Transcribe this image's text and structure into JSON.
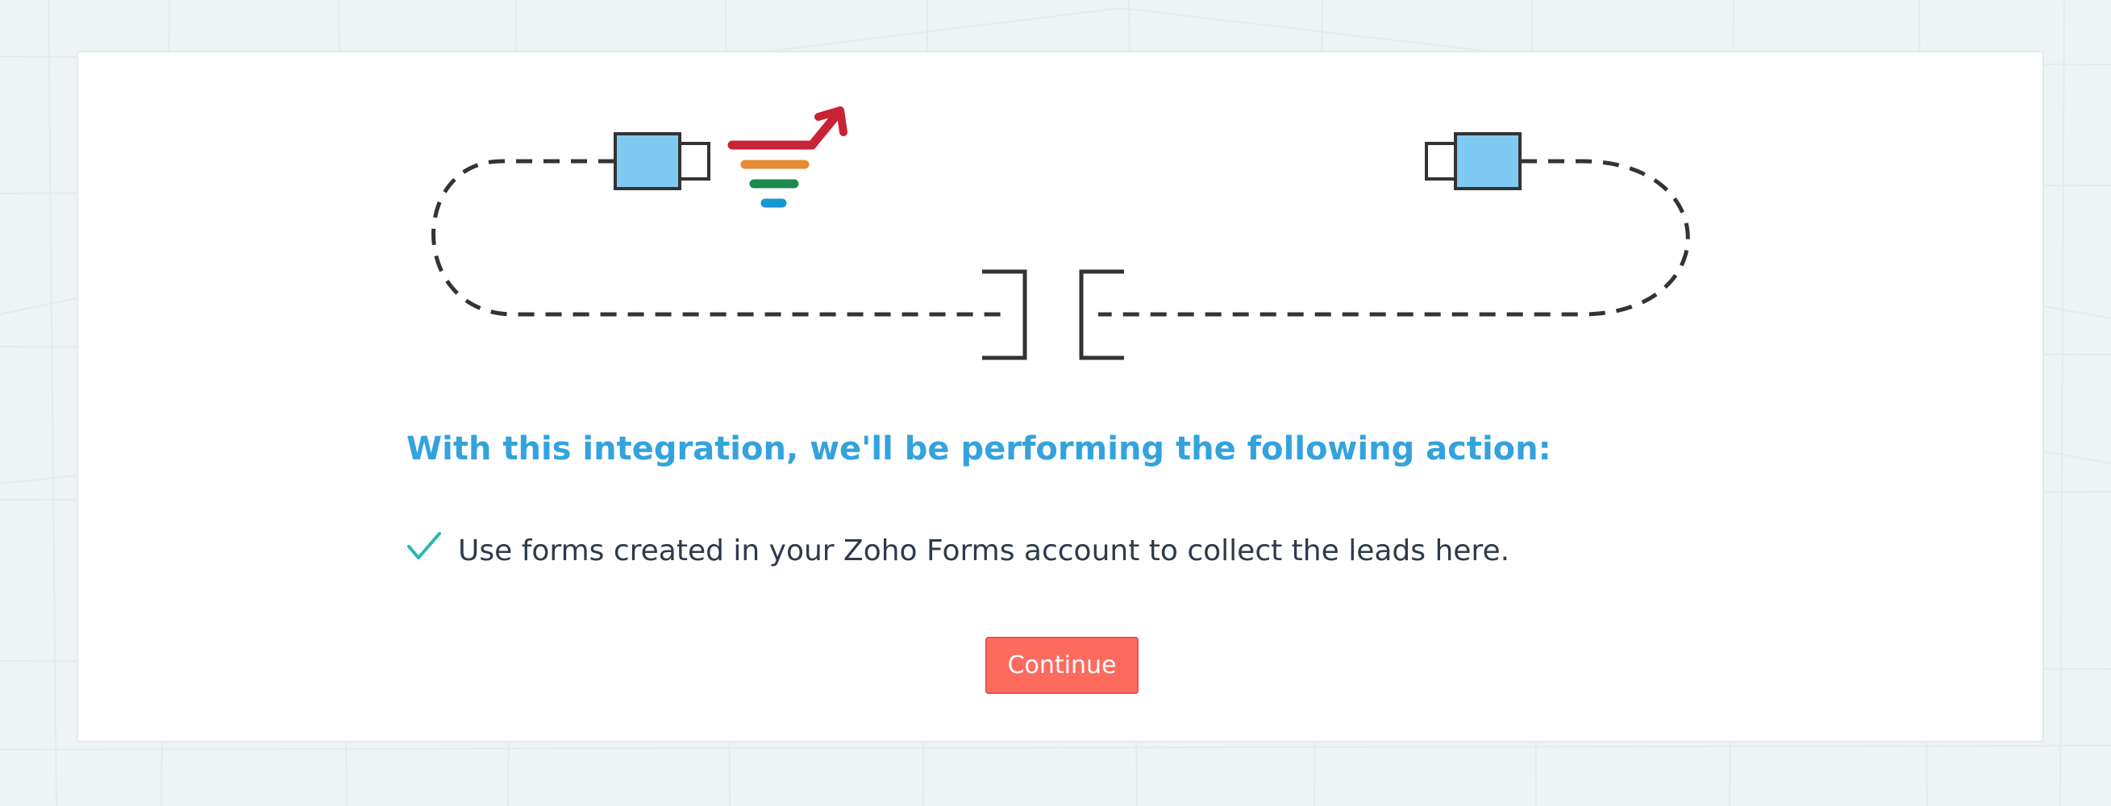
{
  "page": {
    "heading": "With this integration, we'll be performing the following action:",
    "action_text": "Use forms created in your Zoho Forms account to collect the leads here.",
    "continue_label": "Continue"
  },
  "icons": {
    "left_connector": "usb-plug-icon",
    "right_connector": "usb-plug-icon",
    "brand_logo": "funnel-growth-logo-icon",
    "socket": "socket-bracket-icon",
    "check": "check-icon"
  },
  "colors": {
    "background": "#eef4f5",
    "card": "#ffffff",
    "heading": "#34a3dd",
    "text": "#2f3a4a",
    "check": "#2bb6b0",
    "button": "#fd6b5f",
    "plug_fill": "#80c9f3",
    "logo_red": "#c92336",
    "logo_orange": "#e78b35",
    "logo_green": "#1b8a4c",
    "logo_blue": "#1696d3"
  }
}
